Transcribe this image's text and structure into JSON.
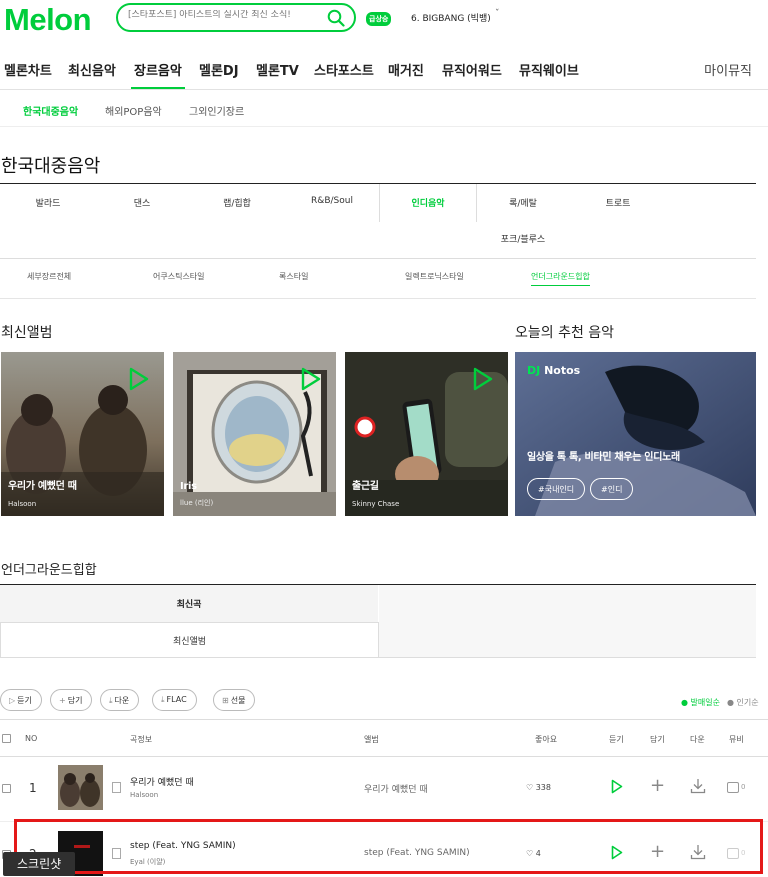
{
  "header": {
    "logo": "Melon",
    "search_placeholder": "[스타포스트] 아티스트의 실시간 최신 소식!",
    "rank_badge": "급상승",
    "rank_text": "6.  BIGBANG (빅뱅)",
    "rank_arrow": "ˇ"
  },
  "gnb": {
    "items": [
      "멜론차트",
      "최신음악",
      "장르음악",
      "멜론DJ",
      "멜론TV",
      "스타포스트",
      "매거진",
      "뮤직어워드",
      "뮤직웨이브"
    ],
    "active_index": 2,
    "my_music": "마이뮤직"
  },
  "subtabs": [
    "한국대중음악",
    "해외POP음악",
    "그외인기장르"
  ],
  "page_title": "한국대중음악",
  "genres": {
    "row1": [
      "발라드",
      "댄스",
      "랩/힙합",
      "R&B/Soul",
      "인디음악",
      "록/메탈",
      "트로트"
    ],
    "row2": [
      "포크/블루스"
    ],
    "active": "인디음악"
  },
  "detail_genres": [
    "세부장르전체",
    "어쿠스틱스타일",
    "록스타일",
    "일렉트로닉스타일",
    "언더그라운드힙합"
  ],
  "latest_albums": {
    "heading": "최신앨범",
    "items": [
      {
        "title": "우리가 예뻤던 때",
        "artist": "Halsoon"
      },
      {
        "title": "Iris",
        "artist": "llue (리인)"
      },
      {
        "title": "출근길",
        "artist": "Skinny Chase"
      }
    ]
  },
  "recommend": {
    "heading": "오늘의 추천 음악",
    "dj_prefix": "DJ",
    "dj_name": "Notos",
    "title": "일상을 톡 톡, 비타민 채우는 인디노래",
    "tags": [
      "#국내인디",
      "#인디"
    ]
  },
  "underground": {
    "title": "언더그라운드힙합",
    "tab_latest_song": "최신곡",
    "tab_latest_album": "최신앨범"
  },
  "actions": {
    "listen": "듣기",
    "add": "담기",
    "download": "다운",
    "flac": "FLAC",
    "gift": "선물",
    "sort_latest": "● 발매일순",
    "sort_popular": "● 인기순"
  },
  "table": {
    "headers": {
      "no": "NO",
      "song": "곡정보",
      "album": "앨범",
      "like": "좋아요",
      "listen": "듣기",
      "add": "담기",
      "down": "다운",
      "mv": "뮤비"
    },
    "rows": [
      {
        "no": "1",
        "title": "우리가 예뻤던 때",
        "artist": "Halsoon",
        "album": "우리가 예뻤던 때",
        "likes": "338",
        "mv": "0"
      },
      {
        "no": "2",
        "title": "step (Feat. YNG SAMIN)",
        "artist": "Eyal (이얄)",
        "album": "step (Feat. YNG SAMIN)",
        "likes": "4",
        "mv": "0"
      }
    ]
  },
  "overlay": {
    "screenshot_label": "스크린샷"
  },
  "colors": {
    "brand": "#00cd3c",
    "highlight": "#e41818"
  }
}
